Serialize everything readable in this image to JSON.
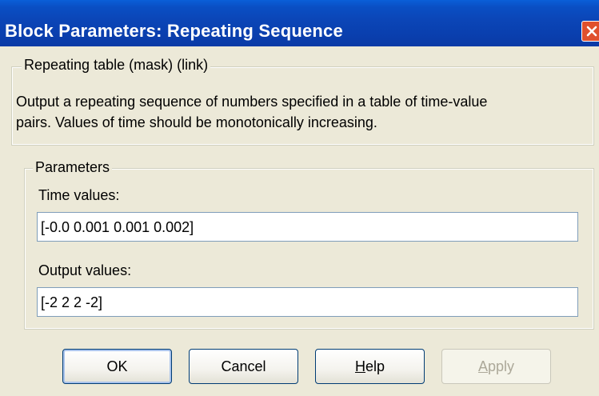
{
  "window": {
    "title": "Block Parameters: Repeating Sequence"
  },
  "mask_group": {
    "legend": "Repeating table (mask) (link)",
    "description_line1": "Output a repeating sequence of numbers specified in a table of time-value",
    "description_line2": "pairs. Values of time should be monotonically increasing."
  },
  "parameters_group": {
    "legend": "Parameters",
    "time_values_label": "Time values:",
    "time_values_value": "[-0.0 0.001 0.001 0.002]",
    "output_values_label": "Output values:",
    "output_values_value": "[-2 2 2 -2]"
  },
  "buttons": {
    "ok": "OK",
    "cancel": "Cancel",
    "help_accel": "H",
    "help_rest": "elp",
    "apply_accel": "A",
    "apply_rest": "pply",
    "apply_enabled": false
  },
  "icons": {
    "close": "close-icon"
  },
  "colors": {
    "titlebar": "#0a46b8",
    "dialog_bg": "#ece9d8",
    "close_button": "#e0502d"
  }
}
